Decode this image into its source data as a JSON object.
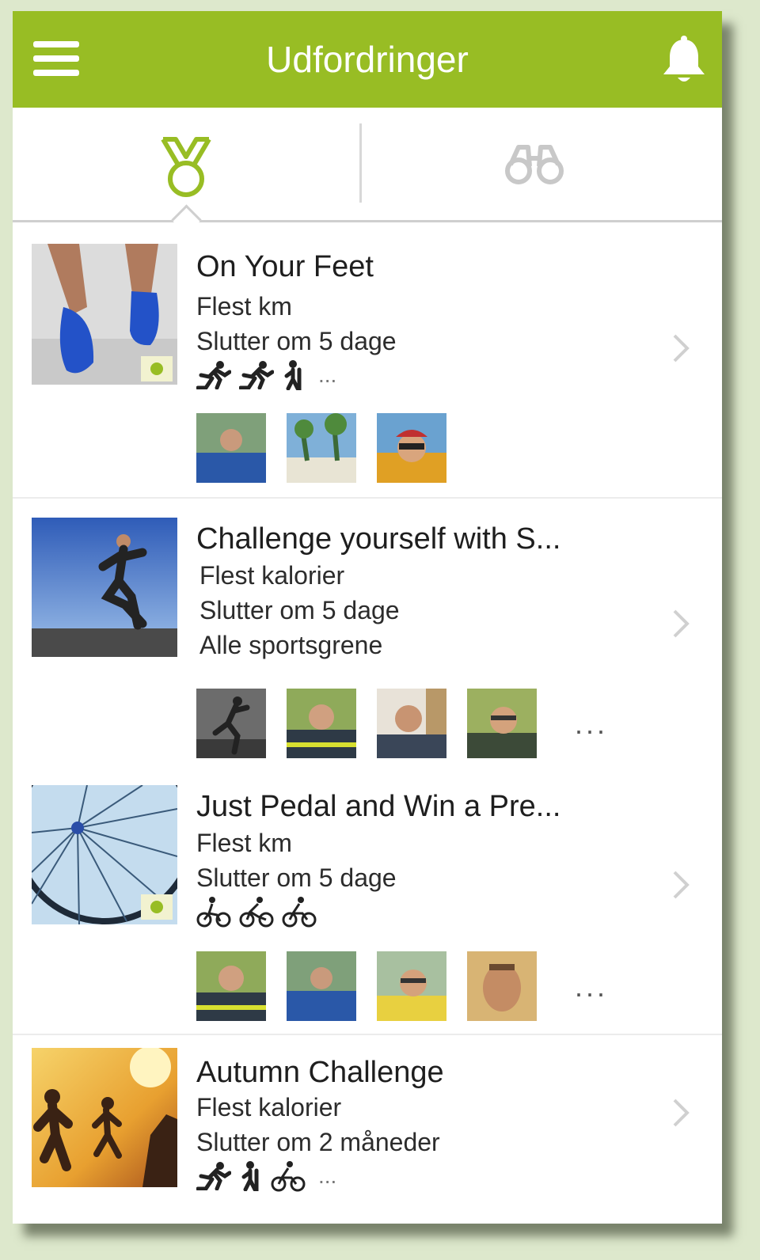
{
  "header": {
    "title": "Udfordringer",
    "menu_icon": "hamburger-menu-icon",
    "notification_icon": "bell-icon",
    "color": "#98bd24"
  },
  "tabs": [
    {
      "icon": "medal-icon",
      "selected": true,
      "color": "#98bd24"
    },
    {
      "icon": "binoculars-icon",
      "selected": false,
      "color": "#c8c8c8"
    }
  ],
  "challenges": [
    {
      "title": "On Your Feet",
      "metric": "Flest km",
      "ends": "Slutter om 5 dage",
      "sports": [
        "running-icon",
        "running-icon",
        "hiking-icon"
      ],
      "more_sports": "...",
      "participants_more": ""
    },
    {
      "title": "Challenge yourself with S...",
      "metric": "Flest kalorier",
      "ends": "Slutter om 5 dage",
      "sports_label": "Alle sportsgrene",
      "participants_more": "..."
    },
    {
      "title": "Just Pedal and Win a Pre...",
      "metric": "Flest km",
      "ends": "Slutter om 5 dage",
      "sports": [
        "cycling-icon",
        "cycling-icon",
        "cycling-icon"
      ],
      "participants_more": "..."
    },
    {
      "title": "Autumn Challenge",
      "metric": "Flest kalorier",
      "ends": "Slutter om 2 måneder",
      "sports": [
        "running-icon",
        "hiking-icon",
        "cycling-icon"
      ],
      "more_sports": "..."
    }
  ]
}
